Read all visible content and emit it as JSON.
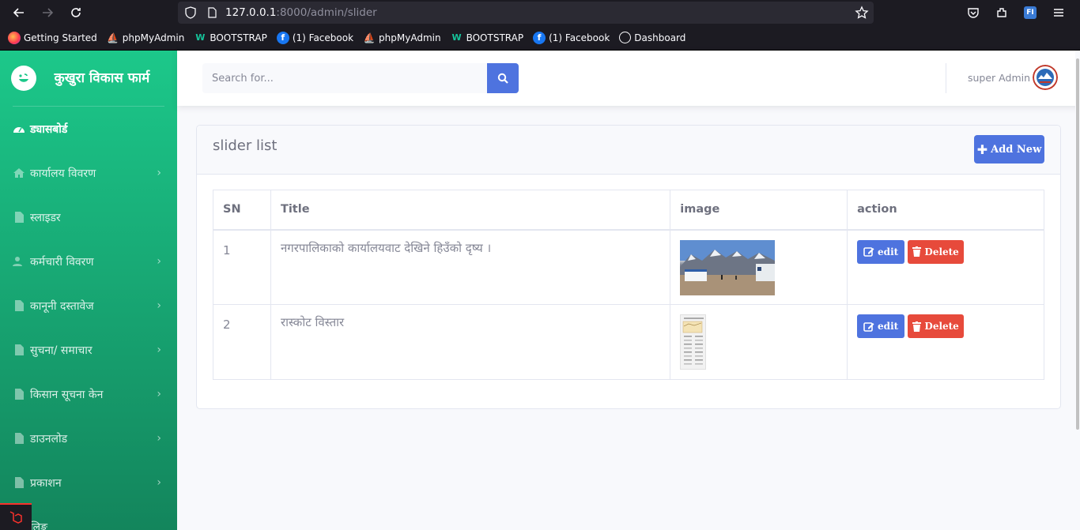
{
  "browser": {
    "url_host": "127.0.0.1",
    "url_path": ":8000/admin/slider",
    "bookmarks": [
      {
        "label": "Getting Started",
        "icon": "firefox-icon"
      },
      {
        "label": "phpMyAdmin",
        "icon": "phpmyadmin-icon"
      },
      {
        "label": "BOOTSTRAP",
        "icon": "bootstrap-icon"
      },
      {
        "label": "(1) Facebook",
        "icon": "facebook-icon"
      },
      {
        "label": "phpMyAdmin",
        "icon": "phpmyadmin-icon"
      },
      {
        "label": "BOOTSTRAP",
        "icon": "bootstrap-icon"
      },
      {
        "label": "(1) Facebook",
        "icon": "facebook-icon"
      },
      {
        "label": "Dashboard",
        "icon": "globe-icon"
      }
    ]
  },
  "sidebar": {
    "brand": "कुखुरा विकास फार्म",
    "items": [
      {
        "label": "ड्यासबोर्ड",
        "icon": "dashboard-icon",
        "active": true,
        "chevron": false
      },
      {
        "label": "कार्यालय विवरण",
        "icon": "home-icon",
        "chevron": true
      },
      {
        "label": "स्लाइडर",
        "icon": "file-icon",
        "chevron": false
      },
      {
        "label": "कर्मचारी विवरण",
        "icon": "users-icon",
        "chevron": true
      },
      {
        "label": "कानूनी दस्तावेज",
        "icon": "file-icon",
        "chevron": true
      },
      {
        "label": "सुचना/ समाचार",
        "icon": "file-icon",
        "chevron": true
      },
      {
        "label": "किसान सूचना केन",
        "icon": "file-icon",
        "chevron": true
      },
      {
        "label": "डाउनलोड",
        "icon": "file-icon",
        "chevron": true
      },
      {
        "label": "प्रकाशन",
        "icon": "file-icon",
        "chevron": true
      },
      {
        "label": "लिङ्क",
        "icon": "file-icon",
        "chevron": false
      }
    ]
  },
  "topbar": {
    "search_placeholder": "Search for...",
    "user_name": "super Admin"
  },
  "card": {
    "title": "slider list",
    "add_label": "Add New"
  },
  "table": {
    "headers": [
      "SN",
      "Title",
      "image",
      "action"
    ],
    "rows": [
      {
        "sn": "1",
        "title": "नगरपालिकाको कार्यालयवाट देखिने हिउँको दृष्य ।",
        "image": "mountain-photo"
      },
      {
        "sn": "2",
        "title": "रास्कोट विस्तार",
        "image": "document-thumbnail"
      }
    ],
    "edit_label": "edit",
    "delete_label": "Delete"
  },
  "colors": {
    "primary": "#4e73df",
    "danger": "#e74a3b",
    "sidebar_top": "#1cc88a",
    "sidebar_bottom": "#13855c"
  }
}
